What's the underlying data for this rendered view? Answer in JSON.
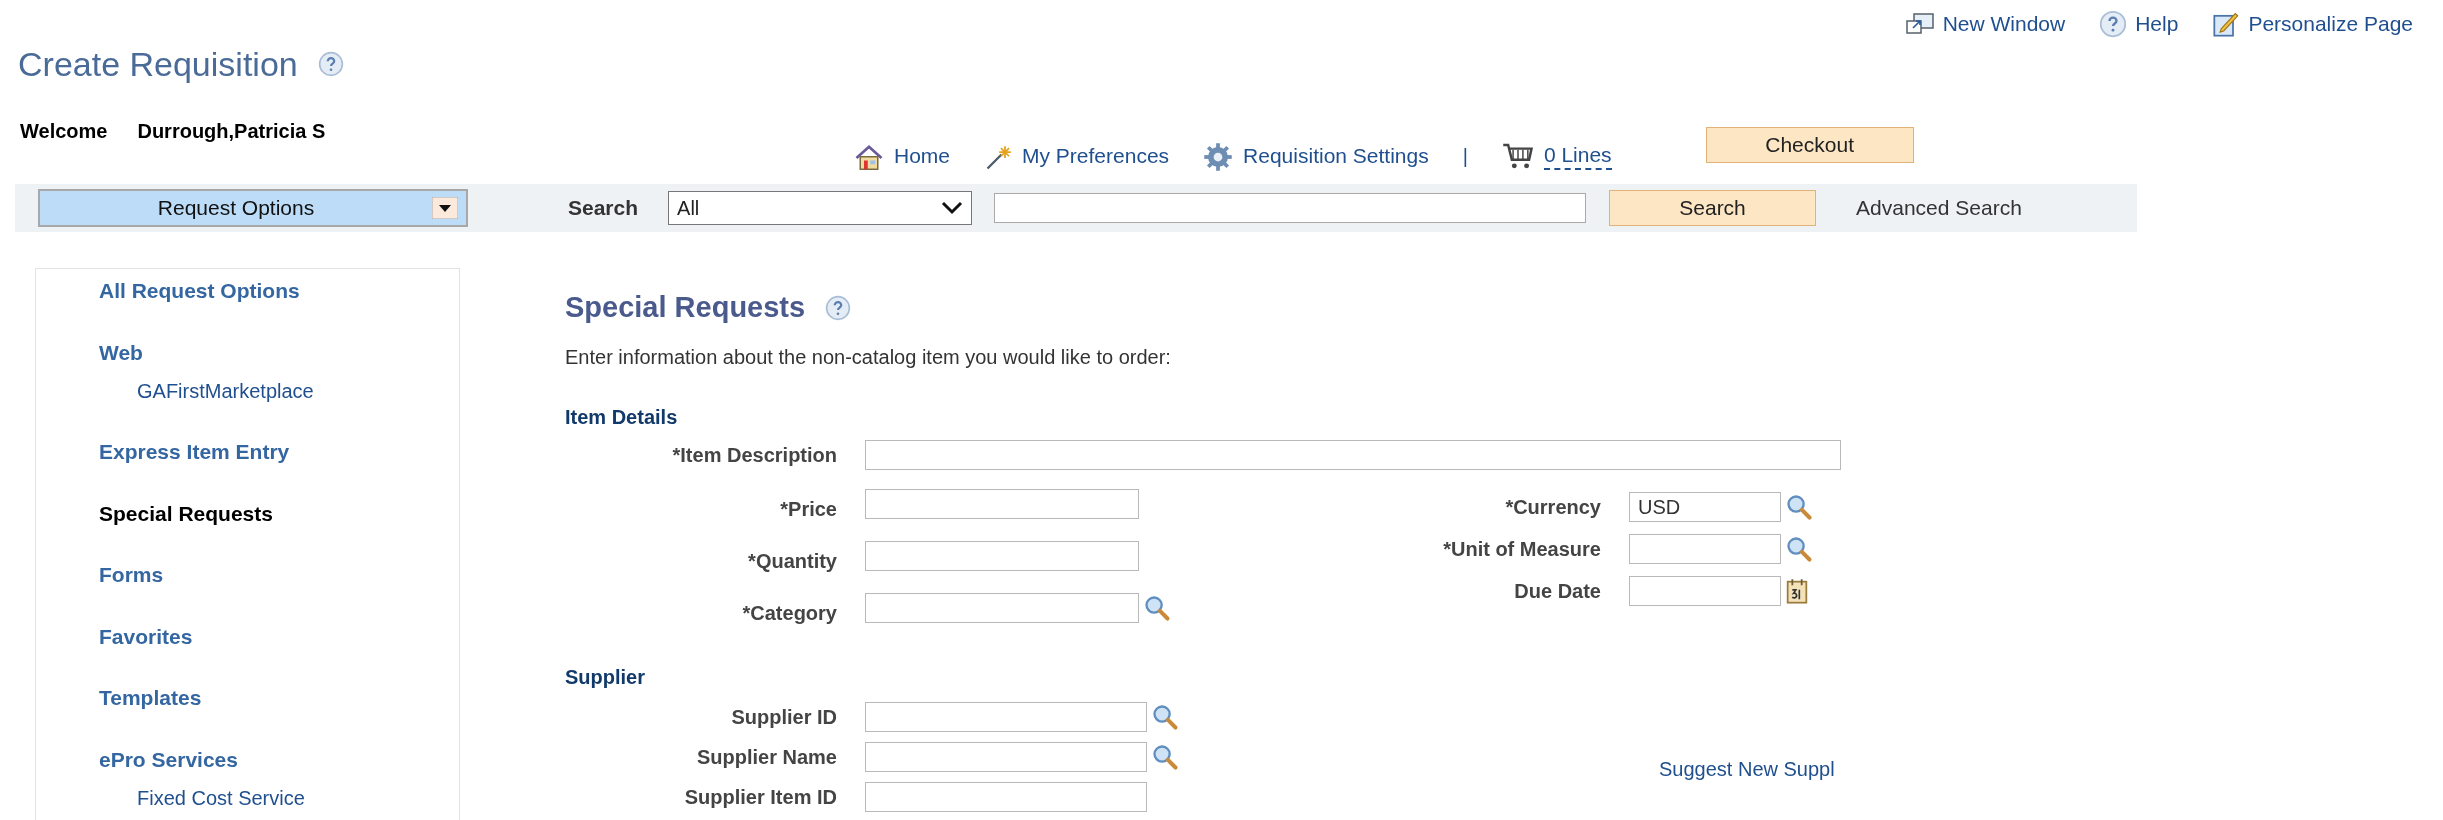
{
  "top_links": [
    {
      "kind": "window",
      "label": "New Window"
    },
    {
      "kind": "help",
      "label": "Help"
    },
    {
      "kind": "personalize",
      "label": "Personalize Page"
    }
  ],
  "title": "Create Requisition",
  "welcome": {
    "label": "Welcome",
    "name": "Durrough,Patricia S"
  },
  "nav": [
    {
      "kind": "home",
      "label": "Home"
    },
    {
      "kind": "wand",
      "label": "My Preferences"
    },
    {
      "kind": "gear",
      "label": "Requisition Settings"
    },
    {
      "kind": "divider",
      "label": "|"
    },
    {
      "kind": "cart",
      "label": "0 Lines"
    }
  ],
  "checkout_button": "Checkout",
  "search_bar": {
    "request_options": "Request Options",
    "search_label": "Search",
    "category": "All",
    "search_button": "Search",
    "advanced": "Advanced Search"
  },
  "sidebar": {
    "items": [
      {
        "label": "All Request Options",
        "selected": false
      },
      {
        "label": "Web",
        "selected": false,
        "children": [
          {
            "label": "GAFirstMarketplace",
            "selected": false
          }
        ]
      },
      {
        "label": "Express Item Entry",
        "selected": false
      },
      {
        "label": "Special Requests",
        "selected": true
      },
      {
        "label": "Forms",
        "selected": false
      },
      {
        "label": "Favorites",
        "selected": false
      },
      {
        "label": "Templates",
        "selected": false
      },
      {
        "label": "ePro Services",
        "selected": false,
        "children": [
          {
            "label": "Fixed Cost Service",
            "selected": false
          }
        ]
      }
    ]
  },
  "main": {
    "title": "Special Requests",
    "intro": "Enter information about the non-catalog item you would like to order:",
    "item_details": {
      "heading": "Item Details",
      "description": {
        "label": "*Item Description"
      },
      "left": [
        {
          "label": "*Price",
          "kind": "plain"
        },
        {
          "label": "*Quantity",
          "kind": "plain"
        },
        {
          "label": "*Category",
          "kind": "search"
        }
      ],
      "right": [
        {
          "label": "*Currency",
          "value": "USD",
          "kind": "search"
        },
        {
          "label": "*Unit of Measure",
          "kind": "search"
        },
        {
          "label": "Due Date",
          "kind": "calendar"
        }
      ]
    },
    "supplier": {
      "heading": "Supplier",
      "fields": [
        {
          "label": "Supplier ID",
          "kind": "search"
        },
        {
          "label": "Supplier Name",
          "kind": "search"
        },
        {
          "label": "Supplier Item ID",
          "kind": "plain"
        }
      ],
      "suggest_link": "Suggest New Suppl"
    }
  }
}
